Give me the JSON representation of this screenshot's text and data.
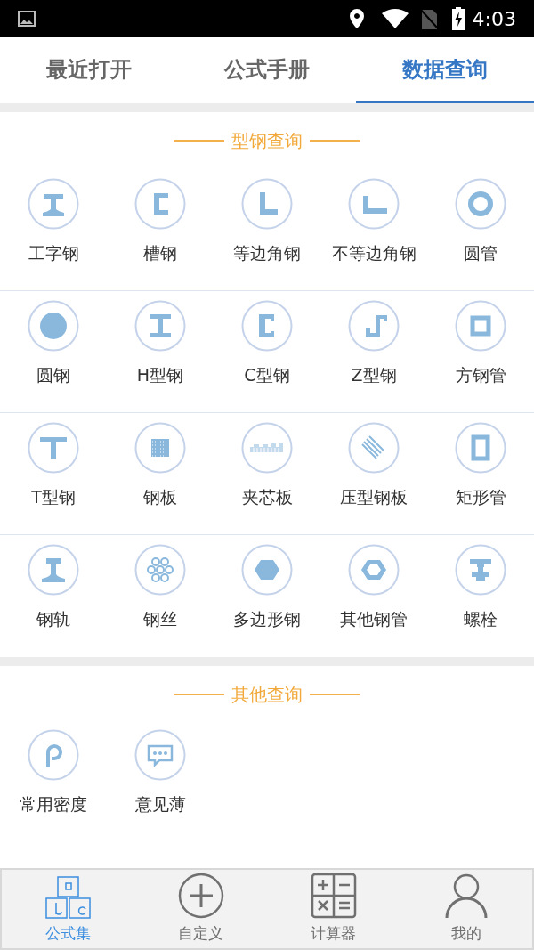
{
  "status_bar": {
    "time": "4:03"
  },
  "tabs": [
    {
      "label": "最近打开",
      "selected": false
    },
    {
      "label": "公式手册",
      "selected": false
    },
    {
      "label": "数据查询",
      "selected": true
    }
  ],
  "sections": [
    {
      "title": "型钢查询",
      "items": [
        {
          "label": "工字钢",
          "kind": "i-beam"
        },
        {
          "label": "槽钢",
          "kind": "channel"
        },
        {
          "label": "等边角钢",
          "kind": "equal-angle"
        },
        {
          "label": "不等边角钢",
          "kind": "unequal-angle"
        },
        {
          "label": "圆管",
          "kind": "round-tube"
        },
        {
          "label": "圆钢",
          "kind": "round-bar"
        },
        {
          "label": "H型钢",
          "kind": "h-beam"
        },
        {
          "label": "C型钢",
          "kind": "c-beam"
        },
        {
          "label": "Z型钢",
          "kind": "z-beam"
        },
        {
          "label": "方钢管",
          "kind": "square-tube"
        },
        {
          "label": "T型钢",
          "kind": "t-beam"
        },
        {
          "label": "钢板",
          "kind": "plate"
        },
        {
          "label": "夹芯板",
          "kind": "sandwich"
        },
        {
          "label": "压型钢板",
          "kind": "deck"
        },
        {
          "label": "矩形管",
          "kind": "rect-tube"
        },
        {
          "label": "钢轨",
          "kind": "rail"
        },
        {
          "label": "钢丝",
          "kind": "wire"
        },
        {
          "label": "多边形钢",
          "kind": "hexagon"
        },
        {
          "label": "其他钢管",
          "kind": "hex-tube"
        },
        {
          "label": "螺栓",
          "kind": "bolt"
        }
      ]
    },
    {
      "title": "其他查询",
      "items": [
        {
          "label": "常用密度",
          "kind": "density"
        },
        {
          "label": "意见薄",
          "kind": "feedback"
        }
      ]
    }
  ],
  "bottom_nav": [
    {
      "label": "公式集",
      "kind": "abc",
      "selected": true
    },
    {
      "label": "自定义",
      "kind": "plus",
      "selected": false
    },
    {
      "label": "计算器",
      "kind": "calc",
      "selected": false
    },
    {
      "label": "我的",
      "kind": "user",
      "selected": false
    }
  ]
}
